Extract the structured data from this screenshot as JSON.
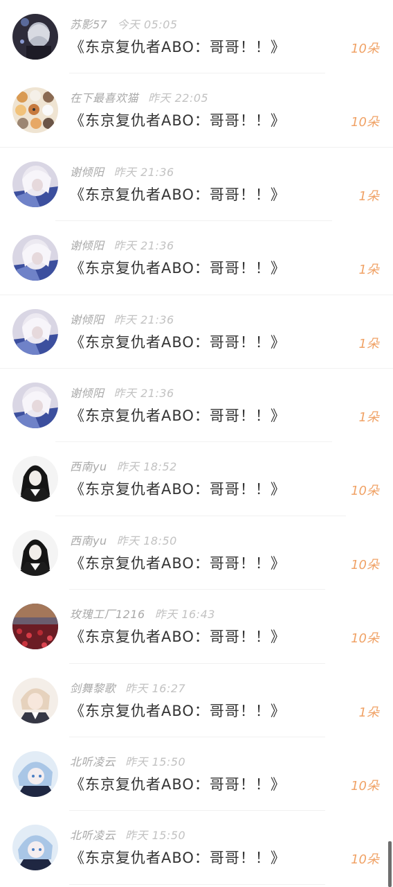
{
  "gift_color": "#f0a266",
  "items": [
    {
      "user": "苏影57",
      "time": "今天 05:05",
      "title": "《东京复仇者ABO：哥哥！！》",
      "gift": "10朵",
      "avatar": "avatar-dark-hair"
    },
    {
      "user": "在下最喜欢猫",
      "time": "昨天 22:05",
      "title": "《东京复仇者ABO：哥哥！！》",
      "gift": "10朵",
      "avatar": "avatar-cats"
    },
    {
      "user": "谢倾阳",
      "time": "昨天 21:36",
      "title": "《东京复仇者ABO：哥哥！！》",
      "gift": "1朵",
      "avatar": "avatar-silver-hair"
    },
    {
      "user": "谢倾阳",
      "time": "昨天 21:36",
      "title": "《东京复仇者ABO：哥哥！！》",
      "gift": "1朵",
      "avatar": "avatar-silver-hair"
    },
    {
      "user": "谢倾阳",
      "time": "昨天 21:36",
      "title": "《东京复仇者ABO：哥哥！！》",
      "gift": "1朵",
      "avatar": "avatar-silver-hair"
    },
    {
      "user": "谢倾阳",
      "time": "昨天 21:36",
      "title": "《东京复仇者ABO：哥哥！！》",
      "gift": "1朵",
      "avatar": "avatar-silver-hair"
    },
    {
      "user": "西南yu",
      "time": "昨天 18:52",
      "title": "《东京复仇者ABO：哥哥！！》",
      "gift": "10朵",
      "avatar": "avatar-black-hair"
    },
    {
      "user": "西南yu",
      "time": "昨天 18:50",
      "title": "《东京复仇者ABO：哥哥！！》",
      "gift": "10朵",
      "avatar": "avatar-black-hair"
    },
    {
      "user": "玫瑰工厂1216",
      "time": "昨天 16:43",
      "title": "《东京复仇者ABO：哥哥！！》",
      "gift": "10朵",
      "avatar": "avatar-rose-field"
    },
    {
      "user": "剑舞黎歌",
      "time": "昨天 16:27",
      "title": "《东京复仇者ABO：哥哥！！》",
      "gift": "1朵",
      "avatar": "avatar-light-hair"
    },
    {
      "user": "北听凌云",
      "time": "昨天 15:50",
      "title": "《东京复仇者ABO：哥哥！！》",
      "gift": "10朵",
      "avatar": "avatar-blue-hair"
    },
    {
      "user": "北听凌云",
      "time": "昨天 15:50",
      "title": "《东京复仇者ABO：哥哥！！》",
      "gift": "10朵",
      "avatar": "avatar-blue-hair"
    }
  ]
}
